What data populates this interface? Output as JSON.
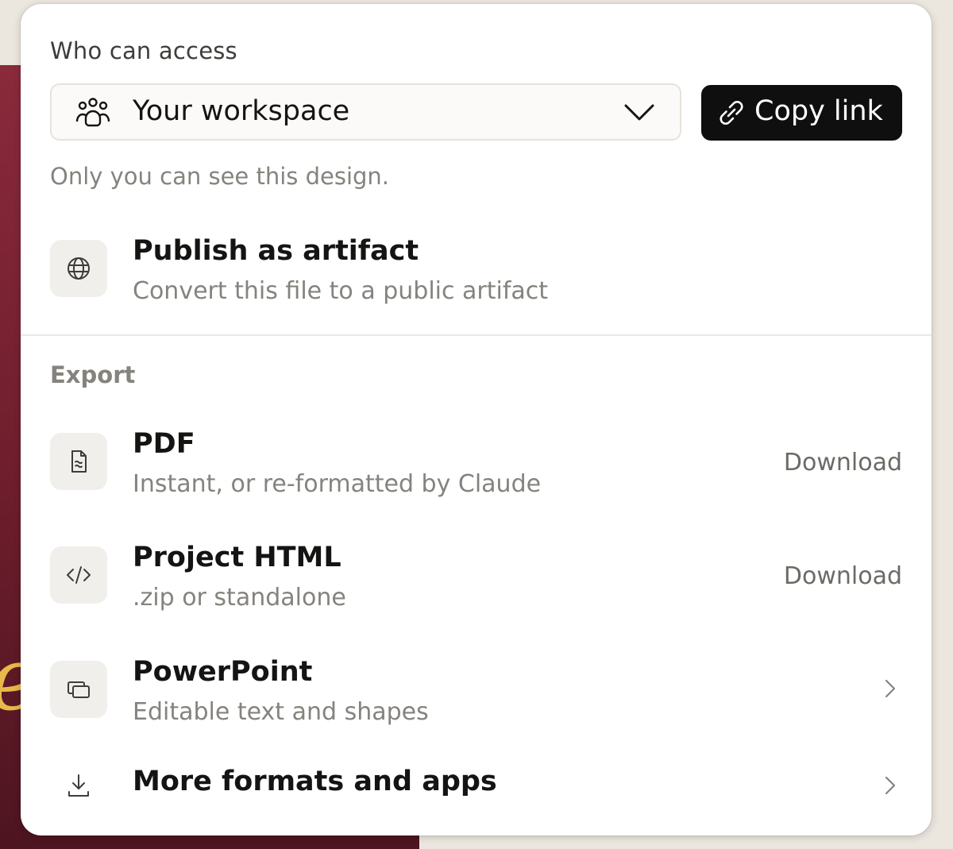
{
  "access": {
    "label": "Who can access",
    "selected": "Your workspace",
    "copy_label": "Copy link",
    "note": "Only you can see this design."
  },
  "publish": {
    "title": "Publish as artifact",
    "subtitle": "Convert this file to a public artifact"
  },
  "export": {
    "label": "Export",
    "items": [
      {
        "title": "PDF",
        "subtitle": "Instant, or re-formatted by Claude",
        "action": "Download",
        "icon": "document-icon"
      },
      {
        "title": "Project HTML",
        "subtitle": ".zip or standalone",
        "action": "Download",
        "icon": "code-icon"
      },
      {
        "title": "PowerPoint",
        "subtitle": "Editable text and shapes",
        "action": "",
        "icon": "slides-icon"
      }
    ],
    "more": {
      "title": "More formats and apps",
      "icon": "download-icon"
    }
  },
  "colors": {
    "primary_button": "#0f0f0f",
    "muted_text": "#85837d",
    "tile_bg": "#f1efeb",
    "backdrop_panel": "#7a2333"
  }
}
